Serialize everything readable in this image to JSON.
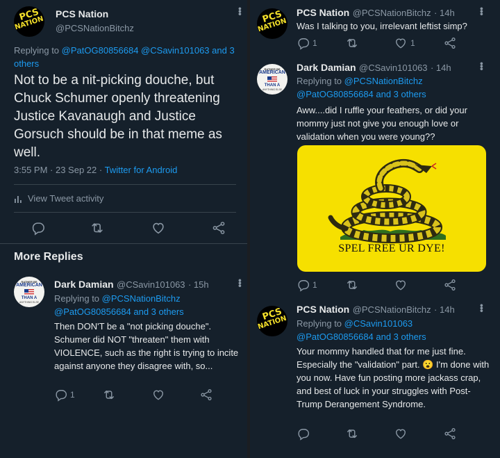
{
  "left": {
    "main_tweet": {
      "avatar_line1": "PCS",
      "avatar_line2": "NATION",
      "name": "PCS Nation",
      "handle": "@PCSNationBitchz",
      "replying_to_label": "Replying to",
      "replying_to_users": "@PatOG80856684 @CSavin101063",
      "replying_to_and": "and",
      "replying_to_others": "3 others",
      "text": "Not to be a nit-picking douche, but Chuck Schumer openly threatening Justice Kavanaugh and Justice Gorsuch should be in that meme as well.",
      "time": "3:55 PM · 23 Sep 22",
      "client": "Twitter for Android",
      "view_activity": "View Tweet activity"
    },
    "more_replies_heading": "More Replies",
    "reply": {
      "avatar_top": "RATHER BE",
      "avatar_mid": "AMERICAN",
      "avatar_than": "THAN A",
      "avatar_bottom": "ANYTHING ELSE",
      "name": "Dark Damian",
      "handle": "@CSavin101063",
      "time": "· 15h",
      "replying_to_label": "Replying to",
      "replying_to_user": "@PCSNationBitchz",
      "replying_to_rest": "@PatOG80856684 and 3 others",
      "text": "Then DON'T be a \"not picking douche\". Schumer did NOT \"threaten\" them with VIOLENCE, such as the right is trying to incite against anyone they disagree with, so...",
      "reply_count": "1"
    }
  },
  "right": {
    "tweet1": {
      "avatar_line1": "PCS",
      "avatar_line2": "NATION",
      "name": "PCS Nation",
      "handle": "@PCSNationBitchz",
      "time": "· 14h",
      "text": "Was I talking to you, irrelevant leftist simp?",
      "reply_count": "1",
      "like_count": "1"
    },
    "tweet2": {
      "avatar_top": "RATHER BE",
      "avatar_mid": "AMERICAN",
      "avatar_than": "THAN A",
      "avatar_bottom": "ANYTHING ELSE",
      "name": "Dark Damian",
      "handle": "@CSavin101063",
      "time": "· 14h",
      "replying_to_label": "Replying to",
      "replying_to_user": "@PCSNationBitchz",
      "replying_to_rest": "@PatOG80856684 and 3 others",
      "text": "Aww....did I ruffle your feathers, or did your mommy just not give you enough love or validation when you were young??",
      "image_caption": "SPEL FREE UR DYE!",
      "reply_count": "1"
    },
    "tweet3": {
      "avatar_line1": "PCS",
      "avatar_line2": "NATION",
      "name": "PCS Nation",
      "handle": "@PCSNationBitchz",
      "time": "· 14h",
      "replying_to_label": "Replying to",
      "replying_to_user": "@CSavin101063",
      "replying_to_rest": "@PatOG80856684 and 3 others",
      "text": "Your mommy handled that for me just fine. Especially the \"validation\" part. 😮 I'm done with you now. Have fun posting more jackass crap, and best of luck in your struggles with Post-Trump Derangement Syndrome."
    }
  },
  "colors": {
    "background": "#15202b",
    "link": "#1d9bf0",
    "muted": "#8b98a5",
    "text": "#e7e9ea",
    "flag_yellow": "#f6e000"
  }
}
